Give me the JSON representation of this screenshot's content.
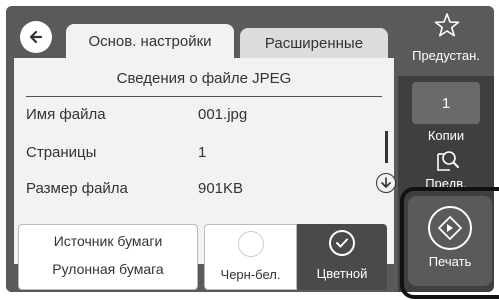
{
  "tabs": {
    "basic": "Основ. настройки",
    "advanced": "Расширенные"
  },
  "file_info": {
    "title": "Сведения о файле JPEG",
    "rows": [
      {
        "label": "Имя файла",
        "value": "001.jpg"
      },
      {
        "label": "Страницы",
        "value": "1"
      },
      {
        "label": "Размер файла",
        "value": "901KB"
      }
    ]
  },
  "paper": {
    "label": "Источник бумаги",
    "value": "Рулонная бумага"
  },
  "color_mode": {
    "bw_label": "Черн-бел.",
    "color_label": "Цветной",
    "selected": "Цветной"
  },
  "sidebar": {
    "preset_label": "Предустан.",
    "copies_value": "1",
    "copies_label": "Копии",
    "preview_label": "Предв.",
    "print_label": "Печать"
  }
}
